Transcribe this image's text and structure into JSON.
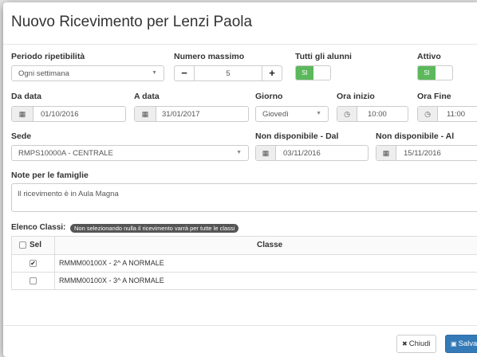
{
  "title": "Nuovo Ricevimento per Lenzi Paola",
  "periodo": {
    "label": "Periodo ripetibilità",
    "value": "Ogni settimana"
  },
  "numero": {
    "label": "Numero massimo",
    "minus": "−",
    "value": "5",
    "plus": "+"
  },
  "tutti": {
    "label": "Tutti gli alunni",
    "toggle": "SI"
  },
  "attivo": {
    "label": "Attivo",
    "toggle": "SI"
  },
  "da_data": {
    "label": "Da data",
    "value": "01/10/2016"
  },
  "a_data": {
    "label": "A data",
    "value": "31/01/2017"
  },
  "giorno": {
    "label": "Giorno",
    "value": "Giovedì"
  },
  "ora_inizio": {
    "label": "Ora inizio",
    "value": "10:00"
  },
  "ora_fine": {
    "label": "Ora Fine",
    "value": "11:00"
  },
  "sede": {
    "label": "Sede",
    "value": "RMPS10000A - CENTRALE"
  },
  "non_disp_dal": {
    "label": "Non disponibile - Dal",
    "value": "03/11/2016"
  },
  "non_disp_al": {
    "label": "Non disponibile - Al",
    "value": "15/11/2016"
  },
  "note": {
    "label": "Note per le famiglie",
    "value": "Il ricevimento è in Aula Magna"
  },
  "elenco": {
    "label": "Elenco Classi:",
    "badge": "Non selezionando nulla il ricevimento varrà per tutte le classi",
    "col_sel": "Sel",
    "col_classe": "Classe",
    "rows": [
      {
        "checked": true,
        "classe": "RMMM00100X - 2^ A NORMALE"
      },
      {
        "checked": false,
        "classe": "RMMM00100X - 3^ A NORMALE"
      }
    ]
  },
  "footer": {
    "close": "Chiudi",
    "save": "Salva"
  },
  "icons": {
    "calendar": "calendar-icon",
    "clock": "clock-icon",
    "close": "times-icon",
    "save": "floppy-icon"
  },
  "colors": {
    "toggle_on": "#5cb85c",
    "primary": "#337ab7",
    "badge": "#555555"
  }
}
